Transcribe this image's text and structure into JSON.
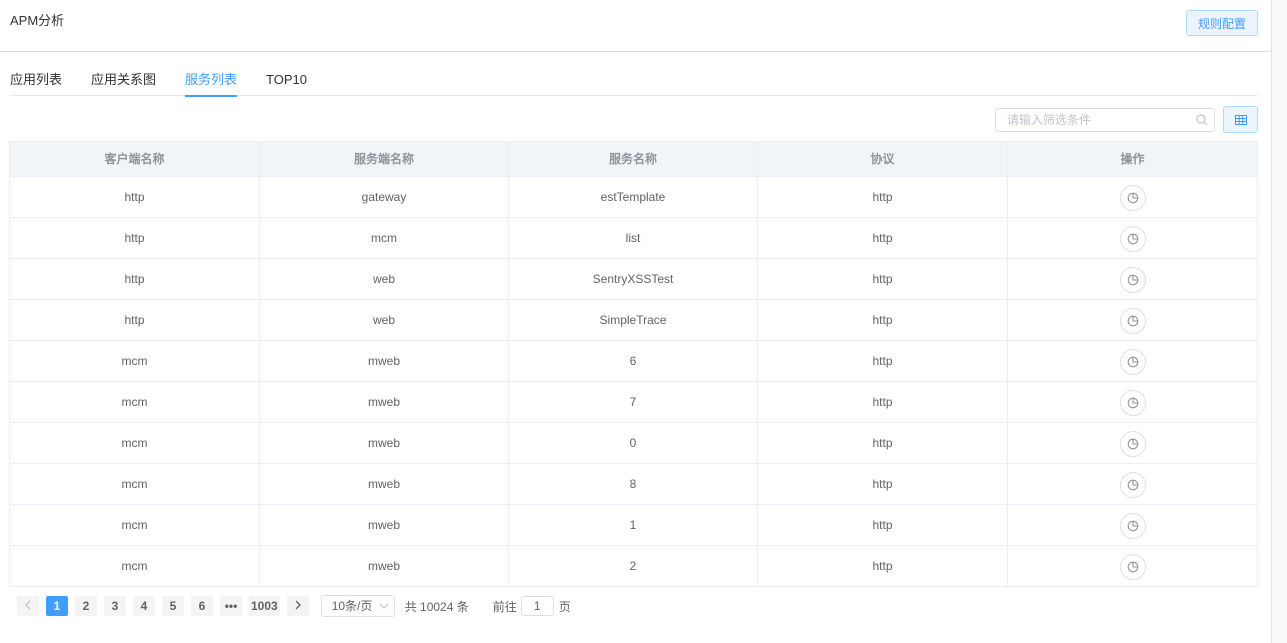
{
  "header": {
    "title": "APM分析",
    "rule_button": "规则配置"
  },
  "tabs": [
    {
      "label": "应用列表",
      "active": false
    },
    {
      "label": "应用关系图",
      "active": false
    },
    {
      "label": "服务列表",
      "active": true
    },
    {
      "label": "TOP10",
      "active": false
    }
  ],
  "filter": {
    "placeholder": "请输入筛选条件",
    "icon": "search-icon",
    "column_button_icon": "table-columns-icon"
  },
  "table": {
    "columns": [
      "客户端名称",
      "服务端名称",
      "服务名称",
      "协议",
      "操作"
    ],
    "rows": [
      {
        "client": "http",
        "server": "gateway",
        "service": "estTemplate",
        "protocol": "http"
      },
      {
        "client": "http",
        "server": "mcm",
        "service": "list",
        "protocol": "http"
      },
      {
        "client": "http",
        "server": "web",
        "service": "SentryXSSTest",
        "protocol": "http"
      },
      {
        "client": "http",
        "server": "web",
        "service": "SimpleTrace",
        "protocol": "http"
      },
      {
        "client": "mcm",
        "server": "mweb",
        "service": "6",
        "protocol": "http"
      },
      {
        "client": "mcm",
        "server": "mweb",
        "service": "7",
        "protocol": "http"
      },
      {
        "client": "mcm",
        "server": "mweb",
        "service": "0",
        "protocol": "http"
      },
      {
        "client": "mcm",
        "server": "mweb",
        "service": "8",
        "protocol": "http"
      },
      {
        "client": "mcm",
        "server": "mweb",
        "service": "1",
        "protocol": "http"
      },
      {
        "client": "mcm",
        "server": "mweb",
        "service": "2",
        "protocol": "http"
      }
    ],
    "row_action_icon": "pie-chart-icon"
  },
  "pagination": {
    "pages": [
      "1",
      "2",
      "3",
      "4",
      "5",
      "6",
      "•••",
      "1003"
    ],
    "current": "1",
    "page_size": "10条/页",
    "total": "共 10024 条",
    "goto_prefix": "前往",
    "goto_value": "1",
    "goto_suffix": "页"
  },
  "colors": {
    "accent": "#409eff",
    "header_bg": "#f2f5f8",
    "border": "#ebeef5"
  }
}
